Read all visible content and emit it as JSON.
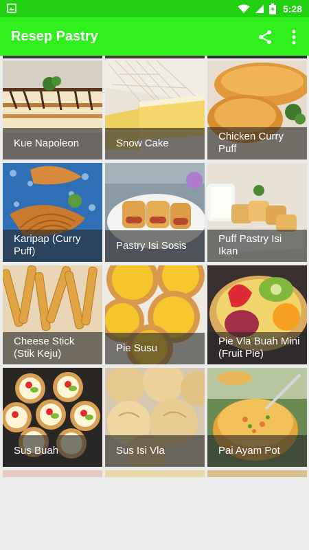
{
  "status_bar": {
    "time": "5:28",
    "icons": [
      "image-icon",
      "wifi-icon",
      "signal-icon",
      "battery-icon"
    ]
  },
  "app_bar": {
    "title": "Resep Pastry",
    "actions": [
      "share-icon",
      "more-vert-icon"
    ],
    "color": "#2ef01a"
  },
  "recipes": [
    {
      "label": "Kue Napoleon"
    },
    {
      "label": "Snow Cake"
    },
    {
      "label": "Chicken Curry Puff"
    },
    {
      "label": "Karipap (Curry Puff)"
    },
    {
      "label": "Pastry Isi Sosis"
    },
    {
      "label": "Puff Pastry Isi Ikan"
    },
    {
      "label": "Cheese Stick (Stik Keju)"
    },
    {
      "label": "Pie Susu"
    },
    {
      "label": "Pie Vla Buah Mini (Fruit Pie)"
    },
    {
      "label": "Sus Buah"
    },
    {
      "label": "Sus Isi Vla"
    },
    {
      "label": "Pai Ayam Pot"
    }
  ]
}
